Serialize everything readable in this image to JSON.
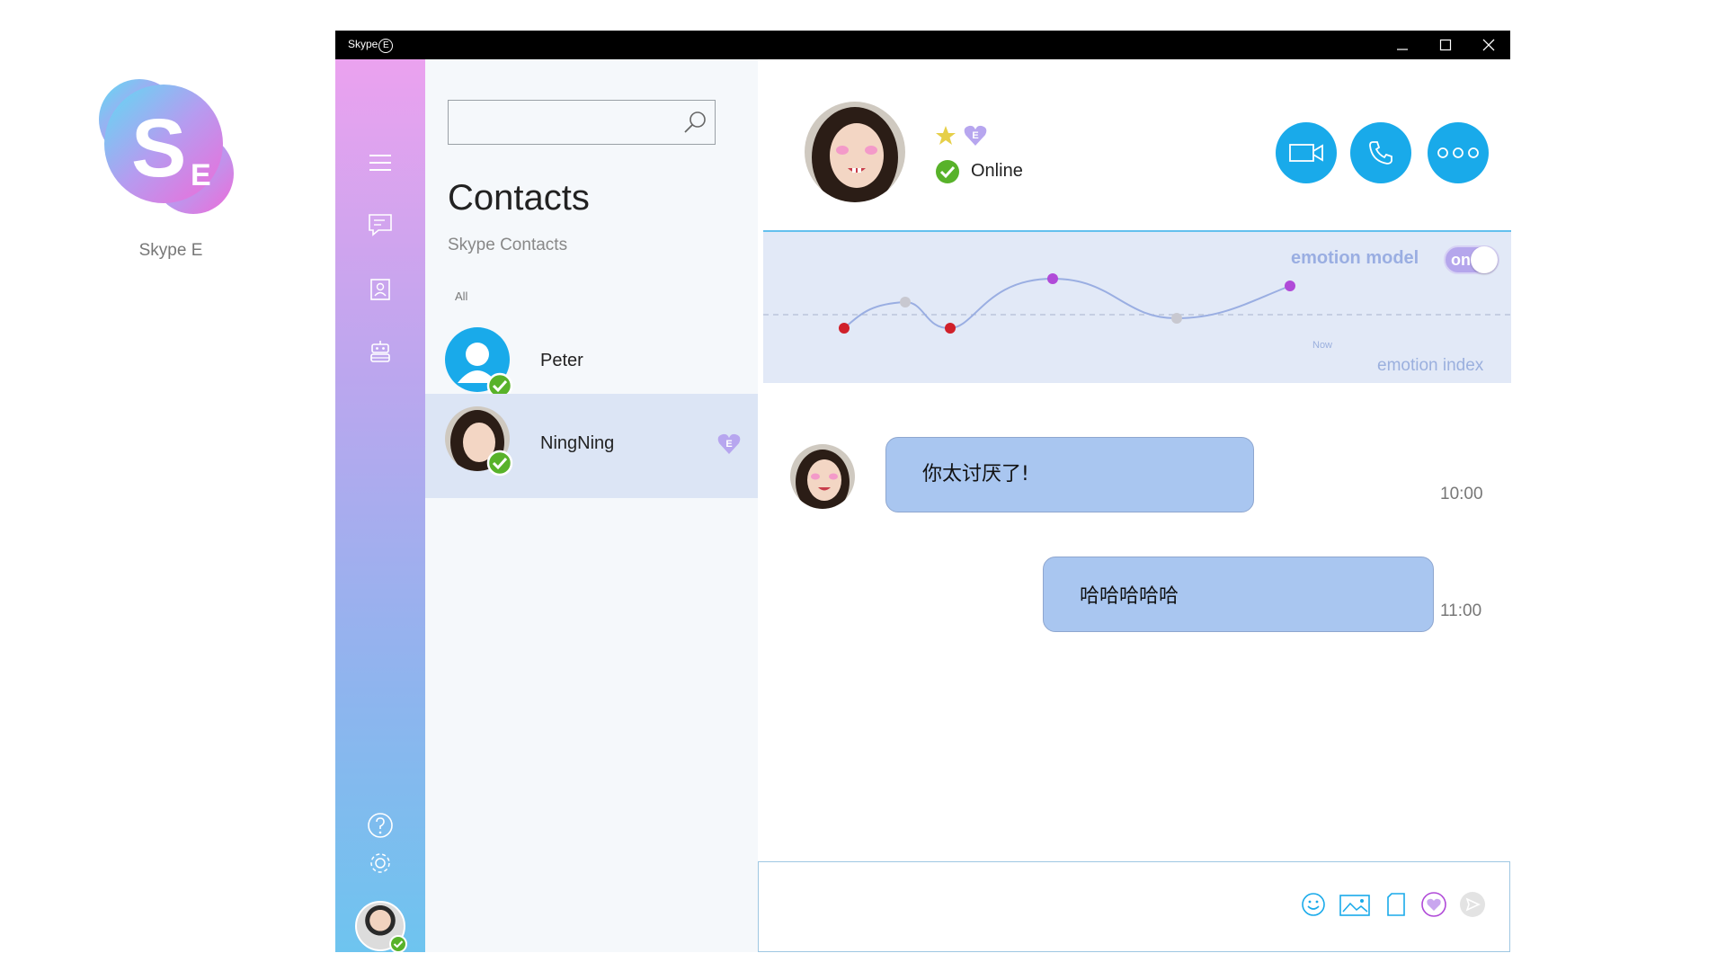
{
  "logo": {
    "letter": "S",
    "sub_letter": "E",
    "caption": "Skype E"
  },
  "titlebar": {
    "title": "Skype",
    "badge": "E"
  },
  "rail": {
    "items": [
      "menu-icon",
      "chat-icon",
      "contacts-icon",
      "bot-icon"
    ],
    "bottom": [
      "help-icon",
      "settings-icon"
    ]
  },
  "contacts": {
    "search_placeholder": "",
    "title": "Contacts",
    "subtitle": "Skype Contacts",
    "filter": "All",
    "items": [
      {
        "name": "Peter",
        "status": "online"
      },
      {
        "name": "NingNing",
        "status": "online",
        "badge": "E",
        "selected": true
      }
    ]
  },
  "chat": {
    "status": "Online",
    "starred": true,
    "badge": "E",
    "actions": [
      "video-call",
      "audio-call",
      "more"
    ],
    "emotion": {
      "model_label": "emotion model",
      "toggle_label": "on",
      "now_label": "Now",
      "index_label": "emotion index"
    },
    "messages": [
      {
        "direction": "in",
        "text": "你太讨厌了!",
        "time": "10:00"
      },
      {
        "direction": "out",
        "text": "哈哈哈哈哈",
        "time": "11:00"
      }
    ],
    "composer": {
      "placeholder": "",
      "tools": [
        "emoji-icon",
        "image-icon",
        "file-icon",
        "emotion-heart-icon",
        "send-icon"
      ]
    }
  },
  "colors": {
    "accent": "#19aaea",
    "online": "#58b22a",
    "bubble": "#a9c6f0",
    "emotion_bg": "#e2e9f7",
    "emotion_point_negative": "#d0202a",
    "emotion_point_neutral": "#c8c8d0",
    "emotion_point_positive": "#b04ad8"
  }
}
